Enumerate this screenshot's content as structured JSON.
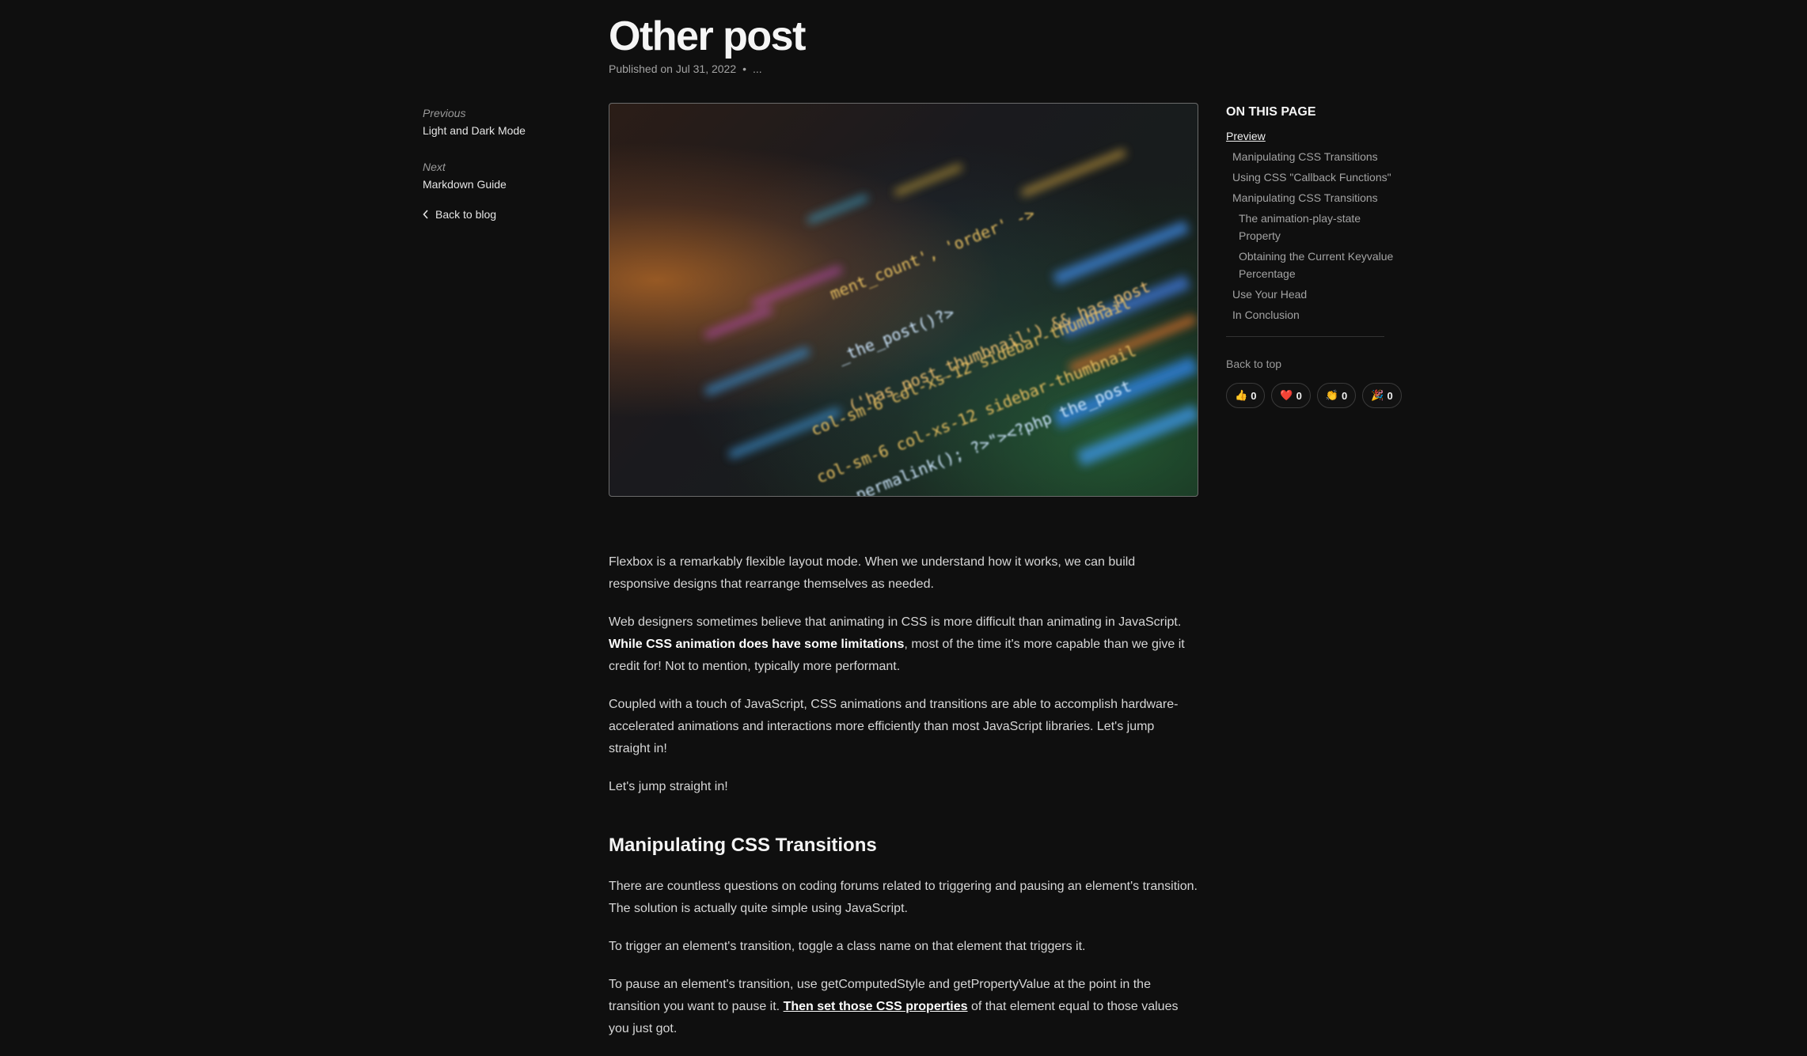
{
  "post": {
    "title": "Other post",
    "published": "Published on Jul 31, 2022",
    "dot": "•",
    "reading": "..."
  },
  "leftnav": {
    "previous_kicker": "Previous",
    "previous_title": "Light and Dark Mode",
    "next_kicker": "Next",
    "next_title": "Markdown Guide",
    "back_label": "Back to blog"
  },
  "hero": {
    "code_lines": [
      "ment_count', 'order' ->",
      "_the_post()?>",
      "('has_post_thumbnail') && has_post",
      "col-sm-6 col-xs-12 sidebar-thumbnail",
      "col-sm-6 col-xs-12 sidebar-thumbnail",
      "the_permalink(); ?>\"><?php the_post"
    ]
  },
  "article": {
    "p1": "Flexbox is a remarkably flexible layout mode. When we understand how it works, we can build responsive designs that rearrange themselves as needed.",
    "p2_a": "Web designers sometimes believe that animating in CSS is more difficult than animating in JavaScript.",
    "p2_bold": "While CSS animation does have some limitations",
    "p2_b": ", most of the time it's more capable than we give it credit for! Not to mention, typically more performant.",
    "p3": "Coupled with a touch of JavaScript, CSS animations and transitions are able to accomplish hardware-accelerated animations and interactions more efficiently than most JavaScript libraries. Let's jump straight in!",
    "p4": "Let's jump straight in!",
    "h2": "Manipulating CSS Transitions",
    "p5": "There are countless questions on coding forums related to triggering and pausing an element's transition. The solution is actually quite simple using JavaScript.",
    "p6": "To trigger an element's transition, toggle a class name on that element that triggers it.",
    "p7_a": "To pause an element's transition, use getComputedStyle and getPropertyValue at the point in the transition you want to pause it. ",
    "p7_link": "Then set those CSS properties",
    "p7_b": " of that element equal to those values you just got."
  },
  "toc": {
    "heading": "ON THIS PAGE",
    "items": [
      "Preview",
      "Manipulating CSS Transitions",
      "Using CSS \"Callback Functions\"",
      "Manipulating CSS Transitions",
      "The animation-play-state Property",
      "Obtaining the Current Keyvalue Percentage",
      "Use Your Head",
      "In Conclusion"
    ],
    "back_top": "Back to top"
  },
  "reactions": [
    {
      "emoji": "👍",
      "count": "0"
    },
    {
      "emoji": "❤️",
      "count": "0"
    },
    {
      "emoji": "👏",
      "count": "0"
    },
    {
      "emoji": "🎉",
      "count": "0"
    }
  ],
  "icons": {
    "back": "chevron-left-icon"
  }
}
